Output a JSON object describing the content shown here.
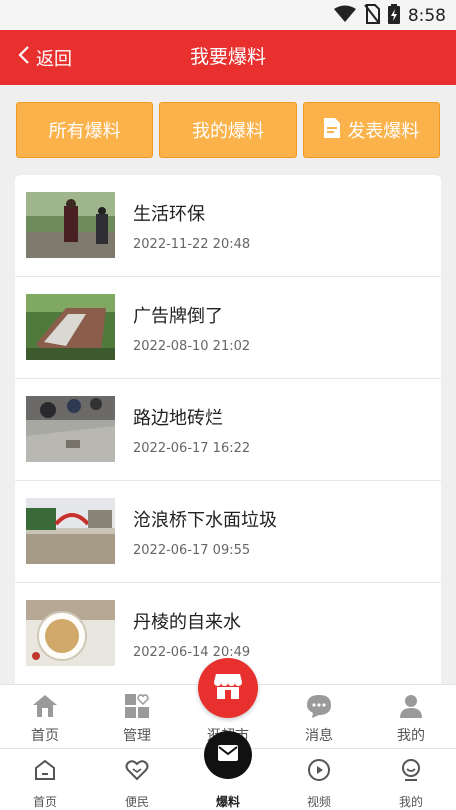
{
  "status_bar": {
    "time": "8:58"
  },
  "header": {
    "back_label": "返回",
    "title": "我要爆料"
  },
  "top_buttons": [
    {
      "label": "所有爆料"
    },
    {
      "label": "我的爆料"
    },
    {
      "label": "发表爆料",
      "icon": "document-icon"
    }
  ],
  "reports": [
    {
      "title": "生活环保",
      "date": "2022-11-22 20:48"
    },
    {
      "title": "广告牌倒了",
      "date": "2022-08-10 21:02"
    },
    {
      "title": "路边地砖烂",
      "date": "2022-06-17 16:22"
    },
    {
      "title": "沧浪桥下水面垃圾",
      "date": "2022-06-17 09:55"
    },
    {
      "title": "丹棱的自来水",
      "date": "2022-06-14 20:49"
    }
  ],
  "tabbar_primary": [
    {
      "label": "首页",
      "icon": "house-icon"
    },
    {
      "label": "管理",
      "icon": "grid-heart-icon"
    },
    {
      "label": "逛超市",
      "icon": "store-icon"
    },
    {
      "label": "消息",
      "icon": "chat-bubble-icon"
    },
    {
      "label": "我的",
      "icon": "person-icon"
    }
  ],
  "tabbar_secondary": [
    {
      "label": "首页",
      "icon": "home-icon"
    },
    {
      "label": "便民",
      "icon": "heart-icon"
    },
    {
      "label": "爆料",
      "icon": "mail-icon",
      "active": true
    },
    {
      "label": "视频",
      "icon": "play-icon"
    },
    {
      "label": "我的",
      "icon": "face-icon"
    }
  ],
  "colors": {
    "brand_red": "#e8312f",
    "button_orange": "#fbb24a",
    "background": "#efefef"
  }
}
